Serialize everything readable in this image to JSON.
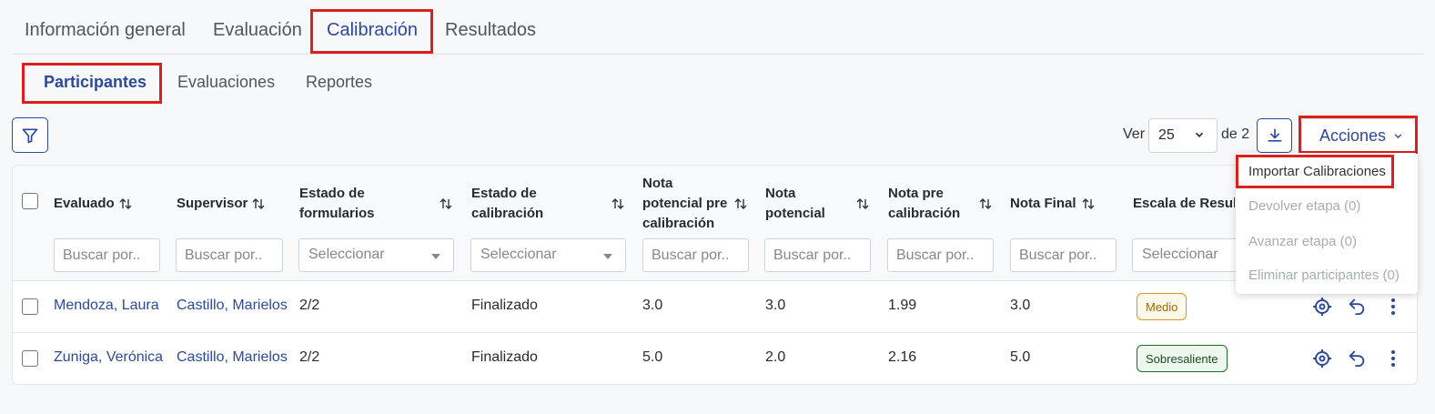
{
  "main_tabs": [
    "Información general",
    "Evaluación",
    "Calibración",
    "Resultados"
  ],
  "sub_tabs": [
    "Participantes",
    "Evaluaciones",
    "Reportes"
  ],
  "toolbar": {
    "ver_label": "Ver",
    "page_size": "25",
    "de_label": "de 2",
    "acciones_label": "Acciones"
  },
  "columns": {
    "evaluado": "Evaluado",
    "supervisor": "Supervisor",
    "estado_formularios": [
      "Estado de",
      "formularios"
    ],
    "estado_calibracion": [
      "Estado de",
      "calibración"
    ],
    "nota_potencial_pre": [
      "Nota",
      "potencial pre",
      "calibración"
    ],
    "nota_potencial": [
      "Nota",
      "potencial"
    ],
    "nota_pre": [
      "Nota pre",
      "calibración"
    ],
    "nota_final": "Nota Final",
    "escala": "Escala de Resul"
  },
  "filters": {
    "search_placeholder": "Buscar por..",
    "select_placeholder": "Seleccionar"
  },
  "rows": [
    {
      "evaluado": "Mendoza, Laura",
      "supervisor": "Castillo, Marielos",
      "formularios": "2/2",
      "calibracion": "Finalizado",
      "pot_pre": "3.0",
      "pot": "3.0",
      "nota_pre": "1.99",
      "nota_final": "3.0",
      "escala": "Medio"
    },
    {
      "evaluado": "Zuniga, Verónica",
      "supervisor": "Castillo, Marielos",
      "formularios": "2/2",
      "calibracion": "Finalizado",
      "pot_pre": "5.0",
      "pot": "2.0",
      "nota_pre": "2.16",
      "nota_final": "5.0",
      "escala": "Sobresaliente"
    }
  ],
  "acciones_menu": [
    "Importar Calibraciones",
    "Devolver etapa (0)",
    "Avanzar etapa (0)",
    "Eliminar participantes (0)"
  ],
  "colors": {
    "accent": "#2d4a9a",
    "highlight": "#dc1f1f",
    "badge_medio": "#d39a22",
    "badge_sobresaliente": "#1e6b2a"
  },
  "icons": [
    "filter-icon",
    "chevron-down-icon",
    "download-icon",
    "sort-icon",
    "target-icon",
    "undo-icon",
    "more-vertical-icon"
  ]
}
